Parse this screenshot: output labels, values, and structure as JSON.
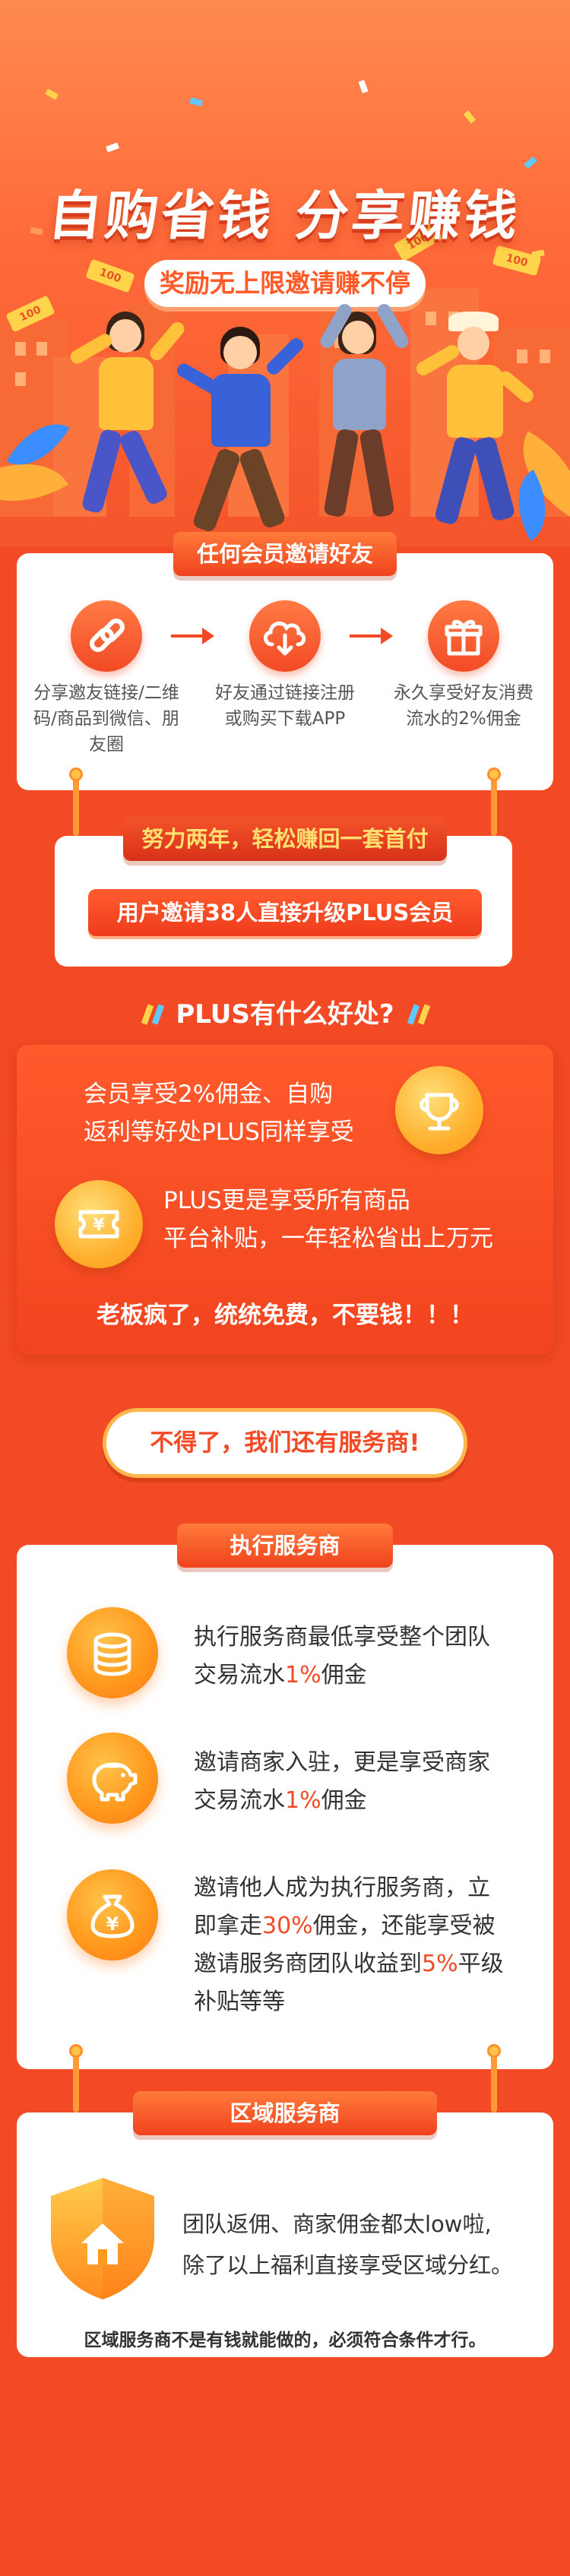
{
  "hero": {
    "title": "自购省钱 分享赚钱",
    "subtitle": "奖励无上限邀请赚不停",
    "coupons": [
      "100",
      "100",
      "100",
      "100"
    ]
  },
  "invite": {
    "ribbon": "任何会员邀请好友",
    "steps": [
      {
        "icon": "link-icon",
        "text": "分享邀友链接/二维码/商品到微信、朋友圈"
      },
      {
        "icon": "cloud-download-icon",
        "text": "好友通过链接注册或购买下载APP"
      },
      {
        "icon": "gift-icon",
        "text": "永久享受好友消费流水的2%佣金"
      }
    ]
  },
  "upgrade": {
    "ribbon": "努力两年，轻松赚回一套首付",
    "banner": "用户邀请38人直接升级PLUS会员"
  },
  "plus": {
    "heading": "PLUS有什么好处?",
    "benefit1": "会员享受2%佣金、自购返利等好处PLUS同样享受",
    "benefit1_lines": [
      "会员享受2%佣金、自购",
      "返利等好处PLUS同样享受"
    ],
    "benefit2_lines": [
      "PLUS更是享受所有商品",
      "平台补贴，一年轻松省出上万元"
    ],
    "slogan": "老板疯了，统统免费，不要钱！！！"
  },
  "more": {
    "button": "不得了，我们还有服务商!"
  },
  "exec": {
    "ribbon": "执行服务商",
    "items": [
      {
        "icon": "coins-icon",
        "lines": [
          "执行服务商最低享受整个团队",
          "交易流水"
        ],
        "highlight": "1%",
        "tail": "佣金"
      },
      {
        "icon": "piggy-bank-icon",
        "lines": [
          "邀请商家入驻，更是享受商家",
          "交易流水"
        ],
        "highlight": "1%",
        "tail": "佣金"
      },
      {
        "icon": "money-bag-icon",
        "line1": "邀请他人成为执行服务商，立",
        "line2_a": "即拿走",
        "line2_hl": "30%",
        "line2_b": "佣金，还能享受被",
        "line3_a": "邀请服务商团队收益到",
        "line3_hl": "5%",
        "line3_b": "平级",
        "line4": "补贴等等"
      }
    ]
  },
  "region": {
    "ribbon": "区域服务商",
    "text_lines": [
      "团队返佣、商家佣金都太low啦,",
      "除了以上福利直接享受区域分红。"
    ],
    "footnote": "区域服务商不是有钱就能做的，必须符合条件才行。"
  },
  "colors": {
    "background": "#f24a25",
    "accent": "#ff9a1e",
    "card": "#ffffff",
    "highlight": "#f24a25"
  }
}
